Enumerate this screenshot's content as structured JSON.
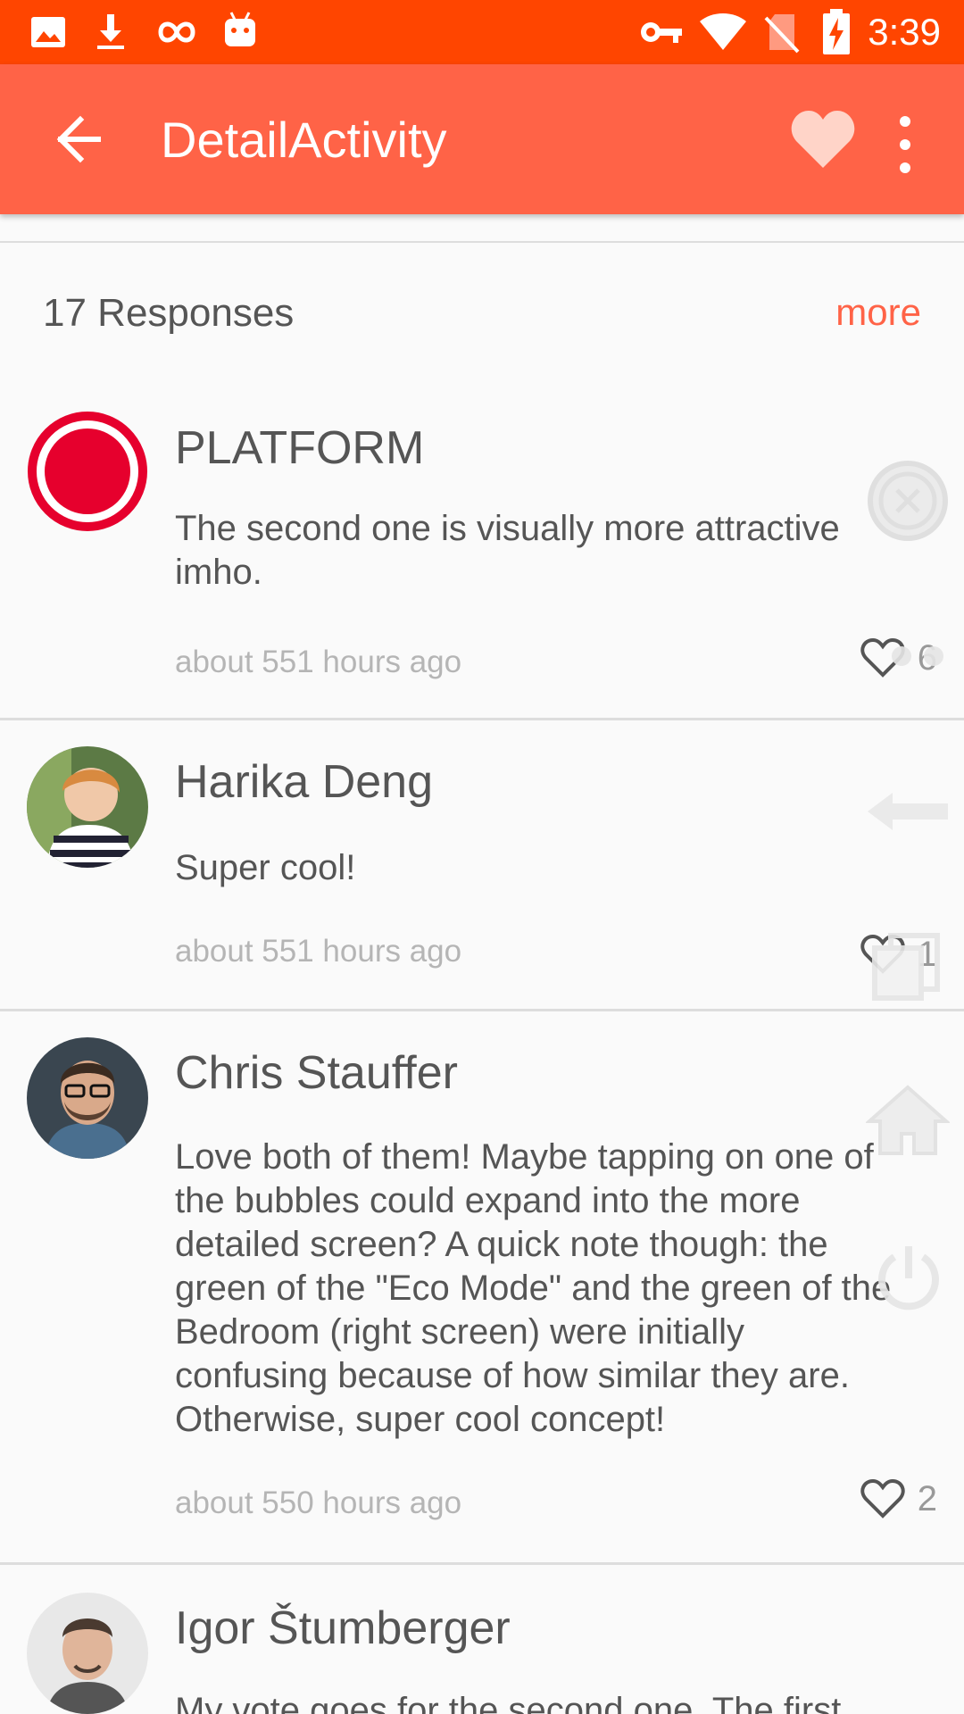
{
  "status_bar": {
    "time": "3:39",
    "left_icons": [
      "image-icon",
      "download-icon",
      "infinity-icon",
      "android-icon"
    ],
    "right_icons": [
      "key-icon",
      "wifi-icon",
      "no-sim-icon",
      "battery-charging-icon"
    ]
  },
  "app_bar": {
    "title": "DetailActivity",
    "color": "#ff6347",
    "status_color": "#ff4500"
  },
  "responses": {
    "count_label": "17 Responses",
    "more_label": "more"
  },
  "comments": [
    {
      "name": "PLATFORM",
      "text": "The second one is visually more attractive imho.",
      "time": "about 551 hours ago",
      "likes": "6",
      "avatar": "record-icon"
    },
    {
      "name": "Harika Deng",
      "text": "Super cool!",
      "time": "about 551 hours ago",
      "likes": "1",
      "avatar": "user-photo"
    },
    {
      "name": "Chris Stauffer",
      "text": "Love both of them! Maybe tapping on one of the bubbles could expand into the more detailed screen? A quick note though: the green of the \"Eco Mode\" and the green of the Bedroom (right screen) were initially confusing because of how similar they are. Otherwise, super cool concept!",
      "time": "about 550 hours ago",
      "likes": "2",
      "avatar": "user-photo"
    },
    {
      "name": "Igor Štumberger",
      "text": "My vote goes for the second one. The first",
      "avatar": "user-photo"
    }
  ],
  "assistive_overlay": [
    "close-icon",
    "menu-dots-icon",
    "back-arrow-icon",
    "recent-apps-icon",
    "home-icon",
    "power-icon"
  ]
}
